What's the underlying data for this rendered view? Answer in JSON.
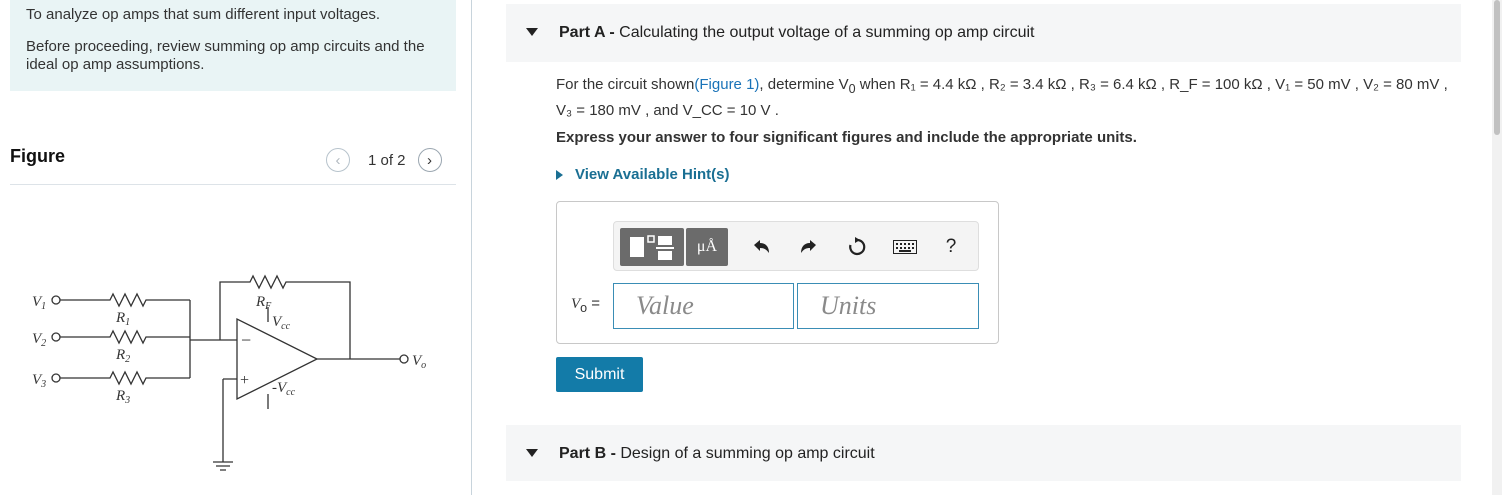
{
  "intro": {
    "line1": "To analyze op amps that sum different input voltages.",
    "line2": "Before proceeding, review summing op amp circuits and the ideal op amp assumptions."
  },
  "figure": {
    "title": "Figure",
    "pager": "1 of 2",
    "prev_icon": "chevron-left-icon",
    "next_icon": "chevron-right-icon",
    "circuit_labels": {
      "v1": "V",
      "v1_sub": "1",
      "v2": "V",
      "v2_sub": "2",
      "v3": "V",
      "v3_sub": "3",
      "r1": "R",
      "r1_sub": "1",
      "r2": "R",
      "r2_sub": "2",
      "r3": "R",
      "r3_sub": "3",
      "rf": "R",
      "rf_sub": "F",
      "vcc": "V",
      "vcc_sub": "cc",
      "nvcc": "-V",
      "nvcc_sub": "cc",
      "vo": "V",
      "vo_sub": "o",
      "minus": "−",
      "plus": "+"
    }
  },
  "partA": {
    "label": "Part A",
    "sep": " - ",
    "title": "Calculating the output voltage of a summing op amp circuit",
    "question_prefix": "For the circuit shown",
    "figure_link": "(Figure 1)",
    "question_rest": ", determine V",
    "vo_sub": "0",
    "given": " when R₁ = 4.4 kΩ , R₂ = 3.4 kΩ , R₃ = 6.4 kΩ , R_F = 100 kΩ , V₁ = 50 mV , V₂ = 80 mV , V₃ = 180 mV , and V_CC = 10 V .",
    "express": "Express your answer to four significant figures and include the appropriate units.",
    "hint": "View Available Hint(s)",
    "toolbar": {
      "template_icon": "template-icon",
      "units_button": "μÅ",
      "undo_icon": "undo-icon",
      "redo_icon": "redo-icon",
      "reset_icon": "reset-icon",
      "keyboard_icon": "keyboard-icon",
      "help": "?"
    },
    "answer_label": "V",
    "answer_label_sub": "o",
    "answer_eq": " =",
    "value_placeholder": "Value",
    "units_placeholder": "Units",
    "submit": "Submit"
  },
  "partB": {
    "label": "Part B",
    "sep": " - ",
    "title": "Design of a summing op amp circuit"
  }
}
